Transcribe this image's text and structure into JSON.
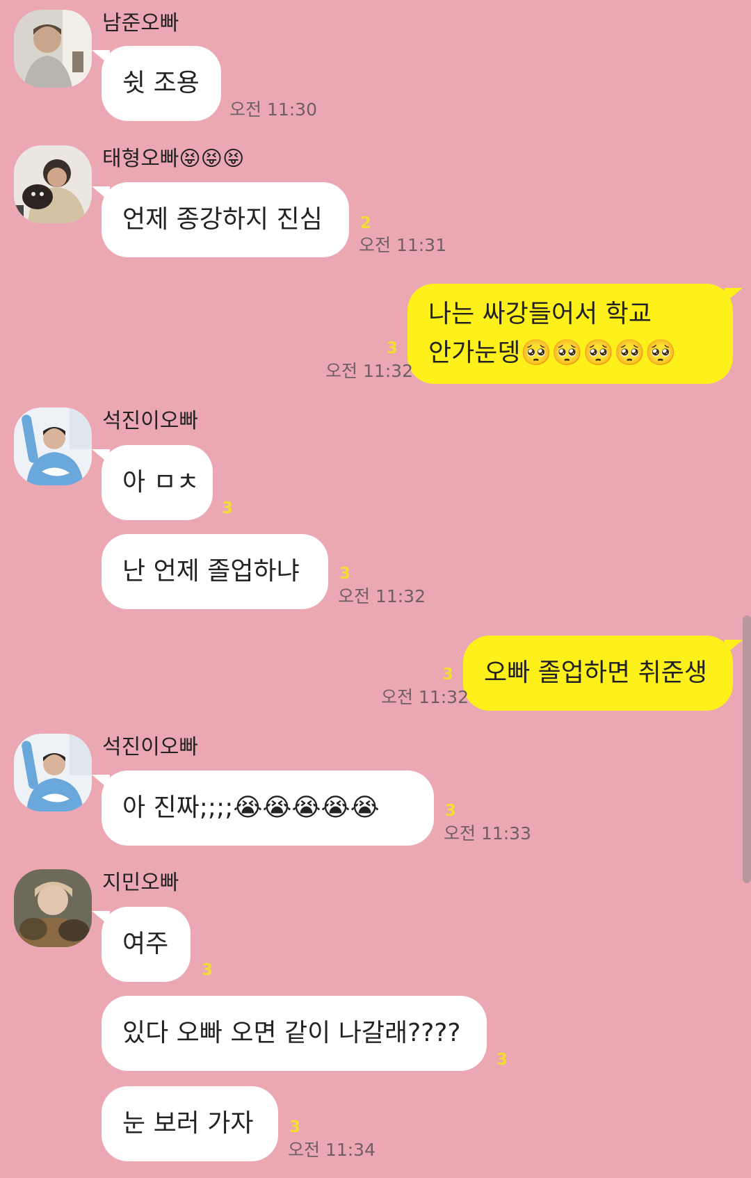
{
  "messages": [
    {
      "sender": "남준오빠",
      "text": "쉿 조용",
      "time": "오전 11:30"
    },
    {
      "sender": "태형오빠😝😝😝",
      "text": "언제 종강하지 진심",
      "unread": "2",
      "time": "오전 11:31"
    },
    {
      "mine": true,
      "line1": "나는 싸강들어서 학교",
      "line2": "안가눈뎅🥺🥺🥺🥺🥺",
      "unread": "3",
      "time": "오전 11:32"
    },
    {
      "sender": "석진이오빠",
      "text": "아 ㅁㅊ",
      "unread": "3"
    },
    {
      "text": "난 언제 졸업하냐",
      "unread": "3",
      "time": "오전 11:32"
    },
    {
      "mine": true,
      "text": "오빠 졸업하면 취준생",
      "unread": "3",
      "time": "오전 11:32"
    },
    {
      "sender": "석진이오빠",
      "text": "아 진짜;;;;😭😭😭😭😭",
      "unread": "3",
      "time": "오전 11:33"
    },
    {
      "sender": "지민오빠",
      "text": "여주",
      "unread": "3"
    },
    {
      "text": "있다 오빠 오면 같이 나갈래????",
      "unread": "3"
    },
    {
      "text": "눈 보러 가자",
      "unread": "3",
      "time": "오전 11:34"
    }
  ],
  "colors": {
    "background": "#eba8b2",
    "bubble_other": "#ffffff",
    "bubble_mine": "#fef01b",
    "unread_count": "#f3dc33",
    "time": "#6e5f62"
  },
  "icons": [
    "profile-photo",
    "pleading-face-emoji",
    "loudly-crying-face-emoji",
    "tongue-out-face-emoji"
  ]
}
